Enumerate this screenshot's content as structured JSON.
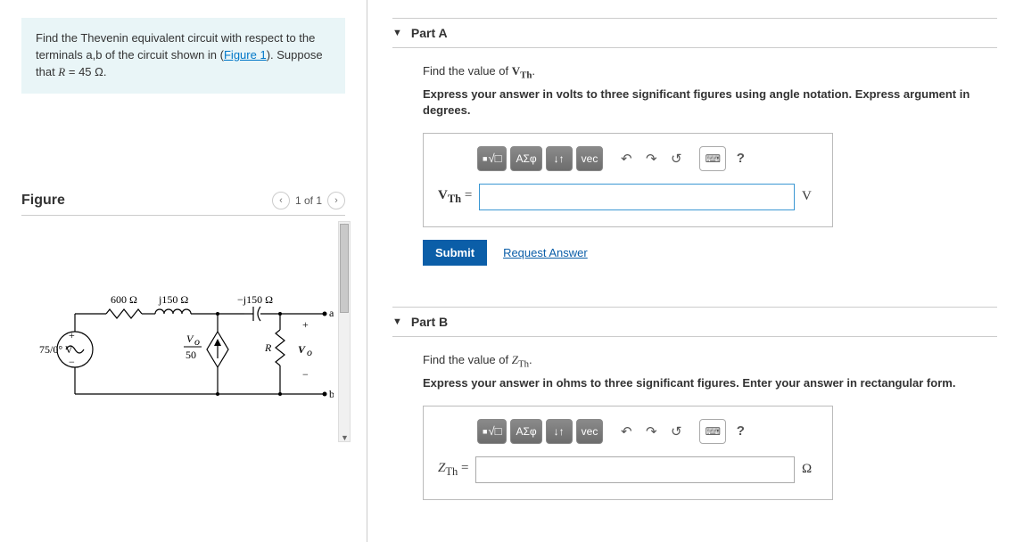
{
  "problem": {
    "intro_prefix": "Find the Thevenin equivalent circuit with respect to the terminals a,b of the circuit shown in (",
    "figure_link": "Figure 1",
    "intro_suffix": "). Suppose that ",
    "equation_lhs": "R",
    "equation_rhs": " = 45 ",
    "unit": "Ω",
    "period": "."
  },
  "figure": {
    "title": "Figure",
    "pager": "1 of 1",
    "labels": {
      "src": "75/0° V",
      "r1": "600 Ω",
      "l1": "j150 Ω",
      "c1": "−j150 Ω",
      "dep_num": "V",
      "dep_sub": "o",
      "dep_den": "50",
      "R": "R",
      "vo": "V",
      "vo_sub": "o",
      "a": "a",
      "b": "b",
      "plus": "+",
      "minus": "−"
    }
  },
  "partA": {
    "title": "Part A",
    "find_prefix": "Find the value of ",
    "find_var": "V",
    "find_sub": "Th",
    "find_suffix": ".",
    "bold": "Express your answer in volts to three significant figures using angle notation. Express argument in degrees.",
    "label_var": "V",
    "label_sub": "Th",
    "label_eq": " =",
    "unit": "V",
    "submit": "Submit",
    "request": "Request Answer"
  },
  "partB": {
    "title": "Part B",
    "find_prefix": "Find the value of ",
    "find_var": "Z",
    "find_sub": "Th",
    "find_suffix": ".",
    "bold": "Express your answer in ohms to three significant figures. Enter your answer in rectangular form.",
    "label_var": "Z",
    "label_sub": "Th",
    "label_eq": " =",
    "unit": "Ω"
  },
  "toolbar": {
    "templates": "□",
    "sqrt": "√□",
    "greek": "ΑΣφ",
    "updown": "↓↑",
    "vec": "vec",
    "undo": "↶",
    "redo": "↷",
    "reset": "↺",
    "keyboard": "⌨",
    "help": "?"
  }
}
